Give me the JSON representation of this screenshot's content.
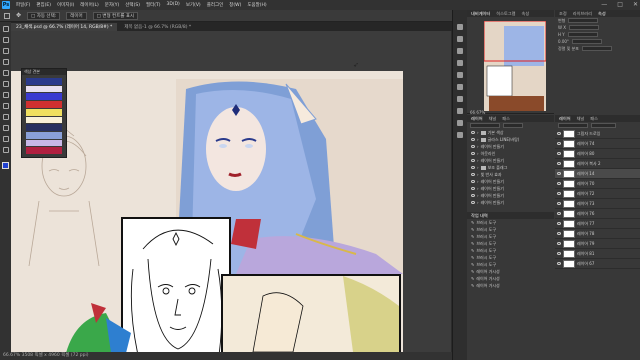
{
  "app": {
    "logo": "Ps",
    "menu": [
      "파일(F)",
      "편집(E)",
      "이미지(I)",
      "레이어(L)",
      "문자(Y)",
      "선택(S)",
      "필터(T)",
      "3D(D)",
      "보기(V)",
      "플러그인",
      "창(W)",
      "도움말(H)"
    ],
    "window_controls": [
      "—",
      "□",
      "✕"
    ]
  },
  "options_bar": {
    "items": [
      "□ 자동 선택:",
      "레이어",
      "□ 변형 컨트롤 표시"
    ],
    "share_label": "공유"
  },
  "document_tabs": [
    {
      "label": "23_채색.psd @ 66.7% (레이어 14, RGB/8#) *",
      "active": true
    },
    {
      "label": "제목 없음-1 @ 66.7% (RGB/8) *",
      "active": false
    }
  ],
  "navigator_window": {
    "title": "색상 견본"
  },
  "swatch_colors": [
    "#2a3a8c",
    "#e8e0f0",
    "#3a3ad0",
    "#d03030",
    "#f0e060",
    "#f8f0d8",
    "#283060",
    "#8aa0d8",
    "#c8b8e8",
    "#b02040"
  ],
  "status_bar": {
    "text": "66.67%   3508 픽셀 x 4960 픽셀 (72 ppi)"
  },
  "right_panel": {
    "nav_tabs": [
      {
        "label": "내비게이터",
        "on": true
      },
      {
        "label": "히스토그램",
        "on": false
      },
      {
        "label": "속성",
        "on": false
      }
    ],
    "props_tabs": [
      {
        "label": "조정",
        "on": false
      },
      {
        "label": "라이브러리",
        "on": false
      },
      {
        "label": "속성",
        "on": true
      }
    ],
    "props_rows": [
      "변형",
      "W  X",
      "H  Y",
      "0.00°",
      "정렬 및 분포"
    ],
    "zoom_label": "66.67%",
    "layers1_tabs": [
      {
        "label": "레이어",
        "on": true
      },
      {
        "label": "채널",
        "on": false
      },
      {
        "label": "패스",
        "on": false
      }
    ],
    "layers1_rows": [
      {
        "label": "기본 색상",
        "folder": true
      },
      {
        "label": "글라스 LINE(바탕)",
        "folder": true
      },
      {
        "label": "레이어 만들기",
        "folder": false
      },
      {
        "label": "아웃라인",
        "folder": false
      },
      {
        "label": "레이어 만들기",
        "folder": false
      },
      {
        "label": "보조 플래그",
        "folder": true
      },
      {
        "label": "빛 반사 효과",
        "folder": false
      },
      {
        "label": "레이어 만들기",
        "folder": false
      },
      {
        "label": "레이어 만들기",
        "folder": false
      },
      {
        "label": "레이어 만들기",
        "folder": false
      },
      {
        "label": "레이어 만들기",
        "folder": false
      }
    ],
    "history_title": "작업 내역",
    "history_rows": [
      "브러시 도구",
      "브러시 도구",
      "브러시 도구",
      "브러시 도구",
      "브러시 도구",
      "브러시 도구",
      "브러시 도구",
      "레이어 가시성",
      "레이어 가시성",
      "레이어 가시성"
    ],
    "layers2_tabs": [
      {
        "label": "레이어",
        "on": true
      },
      {
        "label": "채널",
        "on": false
      },
      {
        "label": "패스",
        "on": false
      }
    ],
    "layers2_rows": [
      {
        "label": "그림자 드로잉",
        "sel": false
      },
      {
        "label": "레이어 74",
        "sel": false
      },
      {
        "label": "레이어 80",
        "sel": false
      },
      {
        "label": "레이어 복사 2",
        "sel": false
      },
      {
        "label": "레이어 14",
        "sel": true
      },
      {
        "label": "레이어 70",
        "sel": false
      },
      {
        "label": "레이어 72",
        "sel": false
      },
      {
        "label": "레이어 73",
        "sel": false
      },
      {
        "label": "레이어 76",
        "sel": false
      },
      {
        "label": "레이어 77",
        "sel": false
      },
      {
        "label": "레이어 78",
        "sel": false
      },
      {
        "label": "레이어 79",
        "sel": false
      },
      {
        "label": "레이어 81",
        "sel": false
      },
      {
        "label": "레이어 67",
        "sel": false
      }
    ]
  }
}
